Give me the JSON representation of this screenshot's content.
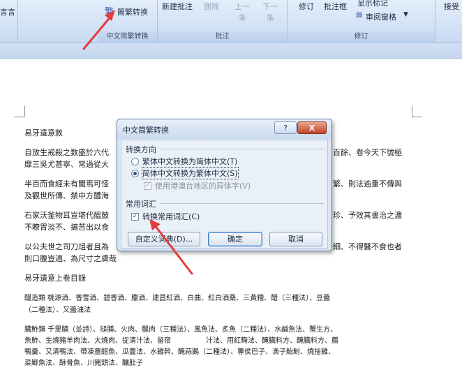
{
  "ribbon": {
    "left_fragment": "言言",
    "convert_button": "簡繁转换",
    "group_chinese": "中文简繁转换",
    "new_comment": "新建批注",
    "delete": "删除",
    "previous": "上一",
    "previous2": "条",
    "next": "下一",
    "next2": "条",
    "group_comments": "批注",
    "track_changes": "修订",
    "markup_box": "批注框",
    "show_markup": "显示标记",
    "review_pane": "审阅窗格",
    "group_tracking": "修订",
    "accept": "接受"
  },
  "dialog": {
    "title": "中文简繁转换",
    "help_label": "?",
    "close_label": "X",
    "direction_label": "转换方向",
    "opt_trad_to_simp": "繁体中文转换为简体中文(T)",
    "opt_simp_to_trad": "简体中文转换为繁体中文(S)",
    "opt_hk_variants": "使用港澳台地区的异体字(V)",
    "vocab_label": "常用词汇",
    "opt_convert_vocab": "转换常用词汇(C)",
    "custom_vocab_button": "自定义词典(D)...",
    "ok_button": "确定",
    "cancel_button": "取消"
  },
  "document": {
    "title_line": "易牙遺意敘",
    "p1_left": "自放生戒殺之数盛於六代",
    "p1_right": "百餘、卷今天下號極",
    "p1_line2": "靡三吳尤甚寧、常過從大",
    "p2_left": "半百而食經未有聞焉可怪",
    "p2_right": "繁、則法逾重不傳與",
    "p2_line2": "及觀世所傳、禁中方醴海",
    "p3_left": "石家沃釜物耳豈堪代醞鼓",
    "p3_right": "珍、予效其書治之濃",
    "p3_line2": "不瞭胃淡不、搞苦出以食",
    "p4_left": "以公夫世之司刀俎者且為",
    "p4_right": "細、不得醫不食也者",
    "p4_line2": "則口腹豈適、為尺寸之膚哉",
    "section_title": "易牙遺意上卷目錄",
    "p5_line1": "醞造類 桃源酒、香雪酒、碧香酒、臘酒、建昌紅酒、白曲、紅白酒藥、三黃糟、醋（三種法）、豆醬",
    "p5_line2": "（二種法）、又醬油法",
    "p6_line1": "臟鮓類 千里脯（並詩）、搥脯、火肉、臘肉（三種法）、風魚法、炙魚（二種法）、水鹹魚法、蟹生方、",
    "p6_line2": "魚鮓、生燒豬羊肉法、大燒肉、捉清汁法、留宿　　　　　汁法、用紅麴法、醃臓料方、醃臓料方、薦",
    "p6_line3": "鴨羹、又清鴨法、帶凍薑醋魚、瓜虀法、水雞幹、醃蒜鵝（二種法）、蓴侯巴子、漁子鮐鮒、燒捨雞、",
    "p6_line4": "菜鯽魚法、酥骨魚、川豬頭法、釀肚子"
  },
  "colors": {
    "ribbon_accent": "#d5e3f6",
    "arrow_red": "#e23c3c",
    "dialog_close": "#c2432a"
  }
}
